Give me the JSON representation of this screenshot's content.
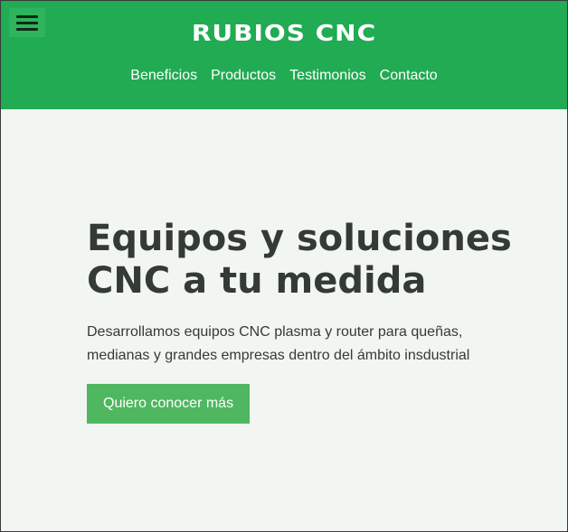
{
  "header": {
    "brand": "RUBIOS CNC",
    "menu_icon": "hamburger-menu-icon",
    "nav": [
      "Beneficios",
      "Productos",
      "Testimonios",
      "Contacto"
    ]
  },
  "hero": {
    "title_line1": "Equipos y soluciones",
    "title_line2": "CNC a tu medida",
    "description": "Desarrollamos equipos CNC plasma y router para queñas, medianas y grandes empresas dentro del ámbito insdustrial",
    "cta_label": "Quiero conocer más"
  },
  "colors": {
    "header_bg": "#21ab52",
    "page_bg": "#f2f6f2",
    "cta_bg": "#4fb75f",
    "text": "#343a35"
  }
}
